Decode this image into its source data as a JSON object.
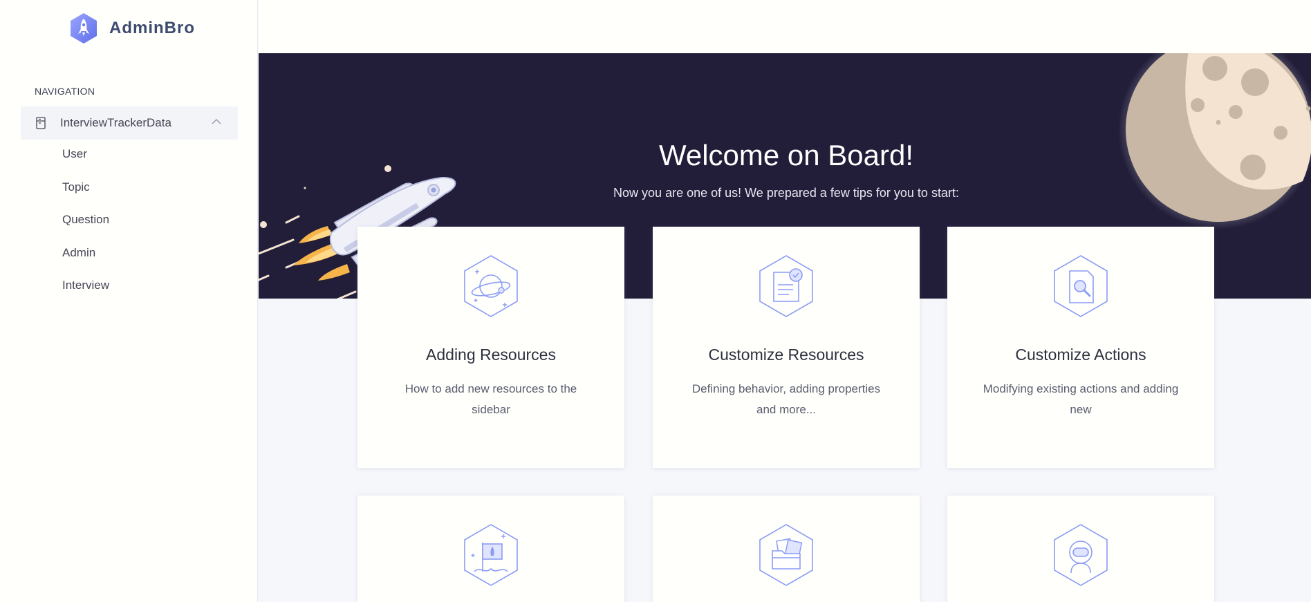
{
  "app": {
    "name": "AdminBro"
  },
  "sidebar": {
    "nav_title": "NAVIGATION",
    "group": {
      "label": "InterviewTrackerData",
      "expanded": true
    },
    "items": [
      {
        "label": "User"
      },
      {
        "label": "Topic"
      },
      {
        "label": "Question"
      },
      {
        "label": "Admin"
      },
      {
        "label": "Interview"
      }
    ]
  },
  "hero": {
    "title": "Welcome on Board!",
    "subtitle": "Now you are one of us! We prepared a few tips for you to start:"
  },
  "cards": [
    {
      "icon": "planet-icon",
      "title": "Adding Resources",
      "text": "How to add new resources to the sidebar"
    },
    {
      "icon": "document-check-icon",
      "title": "Customize Resources",
      "text": "Defining behavior, adding properties and more..."
    },
    {
      "icon": "magnifier-doc-icon",
      "title": "Customize Actions",
      "text": "Modifying existing actions and adding new"
    },
    {
      "icon": "flag-icon",
      "title": "",
      "text": ""
    },
    {
      "icon": "folder-icon",
      "title": "",
      "text": ""
    },
    {
      "icon": "astronaut-icon",
      "title": "",
      "text": ""
    }
  ],
  "colors": {
    "accent": "#8c9cf5",
    "hero_bg": "#221e3a",
    "moon": "#f3e3d0"
  }
}
